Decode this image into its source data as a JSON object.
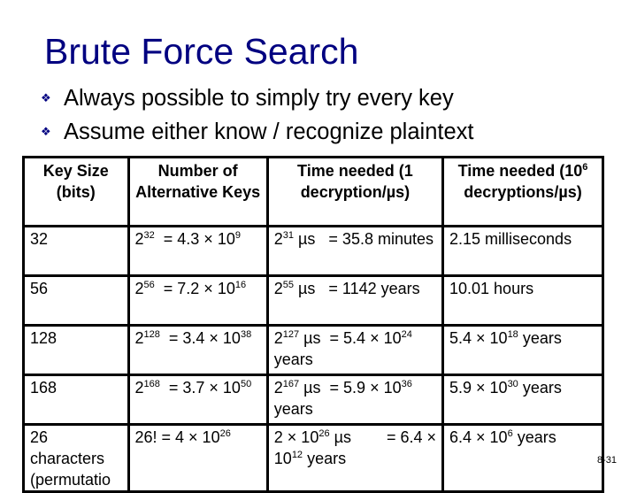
{
  "slide": {
    "title": "Brute Force Search",
    "bullet_icon": "four-diamond-bullet",
    "bullets": [
      "Always possible to simply try every key",
      "Assume either know / recognize plaintext"
    ],
    "page_number": "8-31"
  },
  "colors": {
    "title": "#000080",
    "bullet": "#000080",
    "text": "#000000",
    "border": "#000000",
    "background": "#ffffff"
  },
  "table": {
    "headers": [
      {
        "text": "Key Size (bits)"
      },
      {
        "text": "Number of Alternative Keys"
      },
      {
        "text": "Time needed (1 decryption/µs)"
      },
      {
        "text": "Time needed (10",
        "sup": "6",
        "after": " decryptions/µs)"
      }
    ],
    "rows": [
      {
        "key_size": "32",
        "num_keys": [
          {
            "t": "2"
          },
          {
            "s": "32"
          },
          {
            "t": "  = 4.3 × 10"
          },
          {
            "s": "9"
          }
        ],
        "time_1": [
          {
            "t": "2"
          },
          {
            "s": "31"
          },
          {
            "t": " µs   = 35.8 minutes"
          }
        ],
        "time_1e6": [
          {
            "t": "2.15 milliseconds"
          }
        ]
      },
      {
        "key_size": "56",
        "num_keys": [
          {
            "t": "2"
          },
          {
            "s": "56"
          },
          {
            "t": "  = 7.2 × 10"
          },
          {
            "s": "16"
          }
        ],
        "time_1": [
          {
            "t": "2"
          },
          {
            "s": "55"
          },
          {
            "t": " µs   = 1142 years"
          }
        ],
        "time_1e6": [
          {
            "t": "10.01 hours"
          }
        ]
      },
      {
        "key_size": "128",
        "num_keys": [
          {
            "t": "2"
          },
          {
            "s": "128"
          },
          {
            "t": "  = 3.4 × 10"
          },
          {
            "s": "38"
          }
        ],
        "time_1": [
          {
            "t": "2"
          },
          {
            "s": "127"
          },
          {
            "t": " µs  = 5.4 × 10"
          },
          {
            "s": "24"
          },
          {
            "t": " years"
          }
        ],
        "time_1e6": [
          {
            "t": "5.4 × 10"
          },
          {
            "s": "18"
          },
          {
            "t": " years"
          }
        ]
      },
      {
        "key_size": "168",
        "num_keys": [
          {
            "t": "2"
          },
          {
            "s": "168"
          },
          {
            "t": "  = 3.7 × 10"
          },
          {
            "s": "50"
          }
        ],
        "time_1": [
          {
            "t": "2"
          },
          {
            "s": "167"
          },
          {
            "t": " µs  = 5.9 × 10"
          },
          {
            "s": "36"
          },
          {
            "t": " years"
          }
        ],
        "time_1e6": [
          {
            "t": "5.9 × 10"
          },
          {
            "s": "30"
          },
          {
            "t": " years"
          }
        ]
      },
      {
        "key_size": "26 characters (permutatio",
        "num_keys": [
          {
            "t": "26! = 4 × 10"
          },
          {
            "s": "26"
          }
        ],
        "time_1": [
          {
            "t": "2 × 10"
          },
          {
            "s": "26"
          },
          {
            "t": " µs        = 6.4 × 10"
          },
          {
            "s": "12"
          },
          {
            "t": " years"
          }
        ],
        "time_1e6": [
          {
            "t": "6.4 × 10"
          },
          {
            "s": "6"
          },
          {
            "t": " years"
          }
        ]
      }
    ]
  }
}
